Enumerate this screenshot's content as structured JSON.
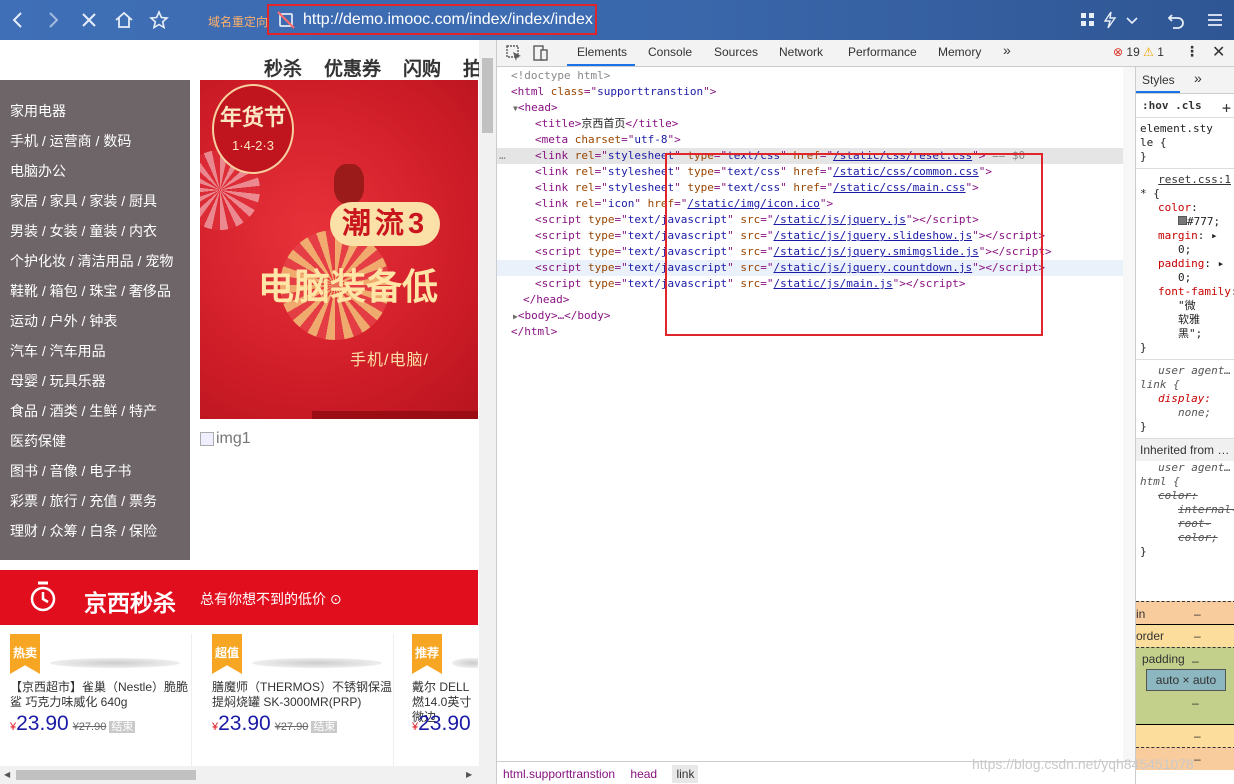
{
  "browser": {
    "redirect_label": "域名重定向",
    "url": "http://demo.imooc.com/index/index/index",
    "icons": [
      "back-icon",
      "forward-icon",
      "stop-icon",
      "home-icon",
      "star-icon",
      "grid-icon",
      "lightning-icon",
      "chevron-down-icon",
      "undo-icon",
      "menu-icon"
    ]
  },
  "page": {
    "nav_tabs": [
      "秒杀",
      "优惠券",
      "闪购",
      "拍"
    ],
    "categories": [
      "家用电器",
      "手机 / 运营商 / 数码",
      "电脑办公",
      "家居 / 家具 / 家装 / 厨具",
      "男装 / 女装 / 童装 / 内衣",
      "个护化妆 / 清洁用品 / 宠物",
      "鞋靴 / 箱包 / 珠宝 / 奢侈品",
      "运动 / 户外 / 钟表",
      "汽车 / 汽车用品",
      "母婴 / 玩具乐器",
      "食品 / 酒类 / 生鲜 / 特产",
      "医药保健",
      "图书 / 音像 / 电子书",
      "彩票 / 旅行 / 充值 / 票务",
      "理财 / 众筹 / 白条 / 保险"
    ],
    "banner": {
      "badge_title": "年货节",
      "badge_date": "1·4-2·3",
      "slogan1": "潮流3",
      "slogan2": "电脑装备低",
      "slogan3": "手机/电脑/"
    },
    "broken_image_alt": "img1",
    "seckill": {
      "title": "京西秒杀",
      "subtitle": "总有你想不到的低价"
    },
    "products": [
      {
        "tag": "热卖",
        "name": "【京西超市】雀巢（Nestle）脆脆鲨 巧克力味威化 640g",
        "currency": "¥",
        "price": "23.90",
        "old_price": "¥27.90",
        "status": "结束"
      },
      {
        "tag": "超值",
        "name": "膳魔师（THERMOS）不锈钢保温提焖烧罐 SK-3000MR(PRP)",
        "currency": "¥",
        "price": "23.90",
        "old_price": "¥27.90",
        "status": "结束"
      },
      {
        "tag": "推荐",
        "name": "戴尔 DELL燃14.0英寸微边",
        "currency": "¥",
        "price": "23.90",
        "old_price": "",
        "status": ""
      }
    ]
  },
  "devtools": {
    "tabs": [
      "Elements",
      "Console",
      "Sources",
      "Network",
      "Performance",
      "Memory"
    ],
    "more_tabs": "»",
    "errors": "19",
    "warnings": "1",
    "code": {
      "doctype": "<!doctype html>",
      "html_open_tag": "html",
      "html_class_attr": "class",
      "html_class_val": "supporttranstion",
      "head_tag": "head",
      "title_text": "京西首页",
      "meta_charset": "utf-8",
      "links": [
        {
          "rel": "stylesheet",
          "type": "text/css",
          "href": "/static/css/reset.css",
          "suffix": "== $0"
        },
        {
          "rel": "stylesheet",
          "type": "text/css",
          "href": "/static/css/common.css",
          "suffix": ""
        },
        {
          "rel": "stylesheet",
          "type": "text/css",
          "href": "/static/css/main.css",
          "suffix": ""
        },
        {
          "rel": "icon",
          "type": "",
          "href": "/static/img/icon.ico",
          "suffix": ""
        }
      ],
      "scripts": [
        "/static/js/jquery.js",
        "/static/js/jquery.slideshow.js",
        "/static/js/jquery.smimgslide.js",
        "/static/js/jquery.countdown.js",
        "/static/js/main.js"
      ],
      "script_type": "text/javascript",
      "body_collapsed": "<body>…</body>",
      "html_close": "</html>",
      "head_close": "</head>"
    },
    "breadcrumb": [
      "html.supporttranstion",
      "head",
      "link"
    ],
    "styles": {
      "tab_label": "Styles",
      "filter_label": ":hov .cls",
      "element_style": [
        "element.sty",
        "le {",
        "}"
      ],
      "rule_source": "reset.css:1",
      "rule_selector": "* {",
      "props": [
        {
          "name": "color",
          "value": "#777;"
        },
        {
          "name": "margin",
          "value": "0;"
        },
        {
          "name": "padding",
          "value": "0;"
        },
        {
          "name": "font-family",
          "value": "\"微软雅黑\";"
        }
      ],
      "user_agent_label": "user agent…",
      "ua_link_rule": "link {",
      "ua_display": "display:",
      "ua_display_value": "none;",
      "inherited_label": "Inherited from …",
      "ua_html_rule": "html {",
      "ua_html_prop": "color:",
      "ua_html_value": "internal-root-color;",
      "box_model": {
        "margin_label": "in",
        "border_label": "order",
        "padding_label": "padding",
        "content": "auto × auto",
        "dash": "–"
      }
    }
  },
  "watermark": "https://blog.csdn.net/yqh845451078",
  "colors": {
    "accent_red": "#e1262b",
    "toolbar_blue": "#3f6fb6",
    "category_bg": "#6e6568",
    "seckill_red": "#e10f1e"
  }
}
